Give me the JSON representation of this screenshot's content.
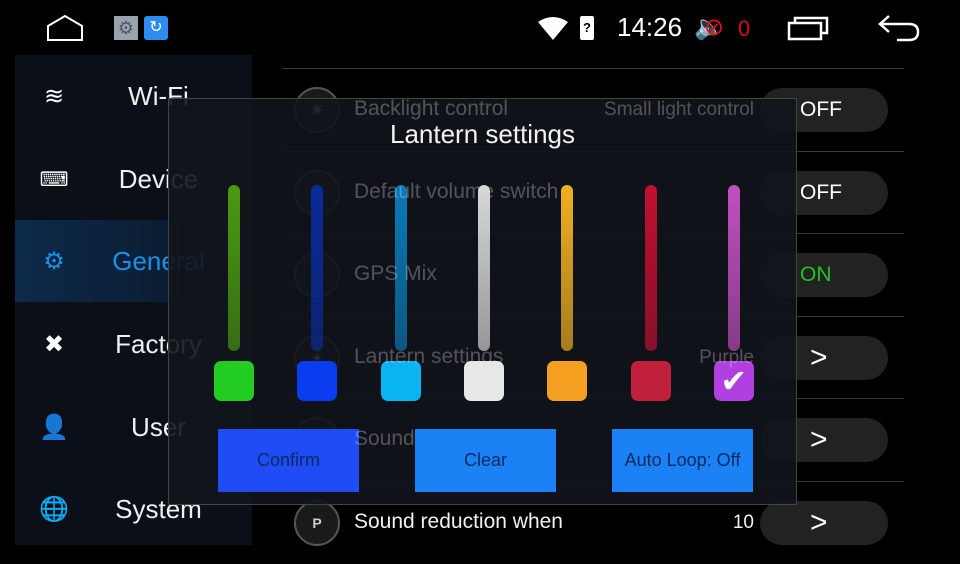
{
  "status_bar": {
    "time": "14:26",
    "volume_count": "0",
    "icons": [
      "home-icon",
      "settings-app-icon",
      "refresh-app-icon",
      "wifi-icon",
      "sim-unknown-icon",
      "volume-muted-icon",
      "recent-apps-icon",
      "back-icon"
    ]
  },
  "sidebar": {
    "items": [
      {
        "label": "Wi-Fi",
        "icon": "wifi-icon",
        "selected": false
      },
      {
        "label": "Device",
        "icon": "monitor-chart-icon",
        "selected": false
      },
      {
        "label": "General",
        "icon": "gear-icon",
        "selected": true
      },
      {
        "label": "Factory",
        "icon": "tools-icon",
        "selected": false
      },
      {
        "label": "User",
        "icon": "user-icon",
        "selected": false
      },
      {
        "label": "System",
        "icon": "globe-icon",
        "selected": false
      }
    ]
  },
  "settings_rows": [
    {
      "label": "Backlight control",
      "value": "Small light control",
      "control": "OFF"
    },
    {
      "label": "Default volume switch",
      "value": "",
      "control": "OFF"
    },
    {
      "label": "GPS Mix",
      "value": "",
      "control": "ON"
    },
    {
      "label": "Lantern settings",
      "value": "Purple",
      "control": ">"
    },
    {
      "label": "Sound",
      "value": "",
      "control": ">"
    },
    {
      "label": "Sound reduction when",
      "value": "10",
      "control": ">"
    }
  ],
  "dialog": {
    "title": "Lantern settings",
    "colors": [
      {
        "name": "green",
        "track": "#4a9a10",
        "swatch": "#22cc22",
        "selected": false
      },
      {
        "name": "blue",
        "track": "#0a2a9a",
        "swatch": "#0a3cf0",
        "selected": false
      },
      {
        "name": "cyan",
        "track": "#0a7ab8",
        "swatch": "#0ab4f0",
        "selected": false
      },
      {
        "name": "white",
        "track": "#d8d8d8",
        "swatch": "#e8e8e8",
        "selected": false
      },
      {
        "name": "orange",
        "track": "#f0b020",
        "swatch": "#f5a020",
        "selected": false
      },
      {
        "name": "red",
        "track": "#c01030",
        "swatch": "#c0203c",
        "selected": false
      },
      {
        "name": "purple",
        "track": "#c050c0",
        "swatch": "#b040e0",
        "selected": true
      }
    ],
    "check_mark": "✔",
    "buttons": {
      "confirm": "Confirm",
      "clear": "Clear",
      "auto_loop": "Auto Loop: Off"
    }
  },
  "colors": {
    "accent": "#1e8fe8",
    "on_text": "#22c022",
    "confirm_bg": "#1f4cf5",
    "button_bg": "#1a82f5"
  }
}
